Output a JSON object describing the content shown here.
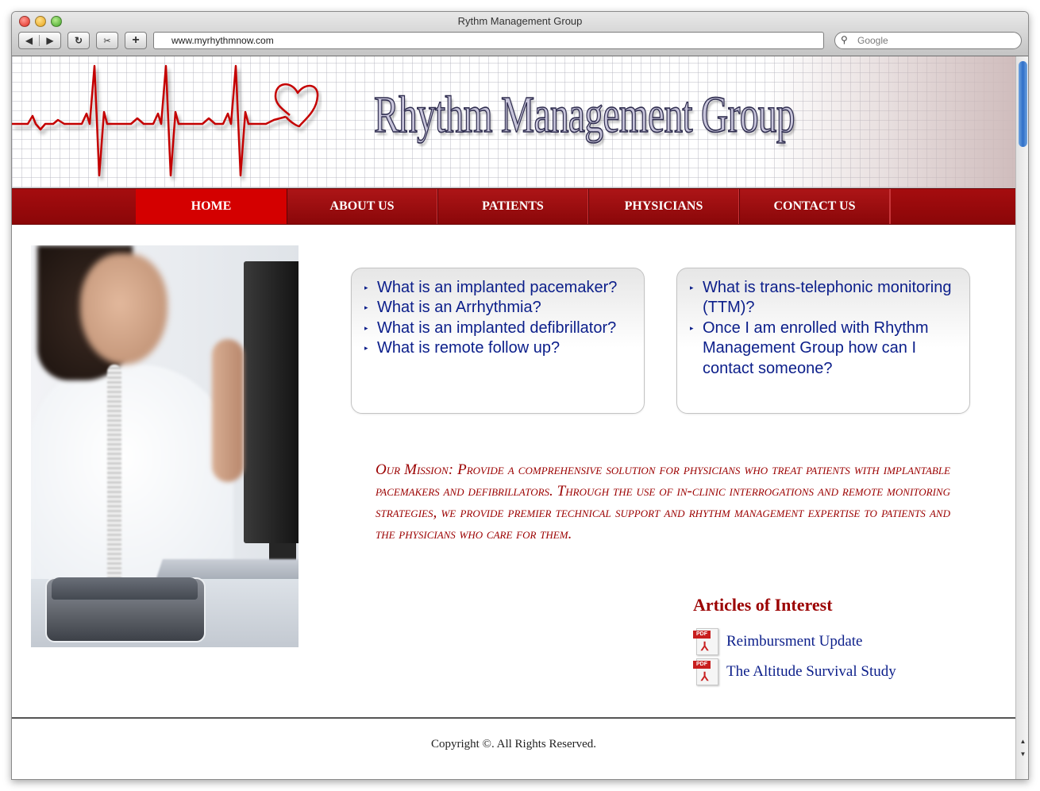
{
  "browser": {
    "window_title": "Rythm Management Group",
    "url": "www.myrhythmnow.com",
    "search_placeholder": "Google",
    "back_glyph": "◀",
    "forward_glyph": "▶",
    "reload_glyph": "↻",
    "snip_glyph": "✂",
    "add_glyph": "+",
    "search_glyph": "🔍"
  },
  "header": {
    "site_title": "Rhythm Management Group"
  },
  "menu": {
    "items": [
      {
        "label": "HOME",
        "active": true
      },
      {
        "label": "ABOUT US",
        "active": false
      },
      {
        "label": "PATIENTS",
        "active": false
      },
      {
        "label": "PHYSICIANS",
        "active": false
      },
      {
        "label": "CONTACT US",
        "active": false
      }
    ]
  },
  "faq_left": {
    "items": [
      "What is an implanted pacemaker?",
      "What is an Arrhythmia?",
      "What is an implanted defibrillator?",
      "What is remote follow up?"
    ]
  },
  "faq_right": {
    "items": [
      "What is trans-telephonic monitoring (TTM)?",
      "Once I am enrolled with Rhythm Management Group how can I contact someone?"
    ]
  },
  "mission": {
    "text": "Our Mission: Provide a comprehensive solution for physicians who treat patients with implantable pacemakers and defibrillators. Through the use of in-clinic interrogations and remote monitoring strategies, we provide premier technical support and rhythm management expertise to patients and the physicians who care for them."
  },
  "articles": {
    "title": "Articles of Interest",
    "pdf_tag": "PDF",
    "items": [
      {
        "label": "Reimbursment Update"
      },
      {
        "label": "The Altitude Survival Study"
      }
    ]
  },
  "footer": {
    "copyright": "Copyright ©. All Rights Reserved."
  },
  "colors": {
    "menu_red": "#9b0a0c",
    "menu_active": "#d40000",
    "link_blue": "#0b1e8a",
    "mission_red": "#9b0000",
    "ecg_red": "#c40000"
  },
  "icons": {
    "bullet": "▸",
    "pdf": "pdf-icon",
    "heart": "heart-icon"
  }
}
